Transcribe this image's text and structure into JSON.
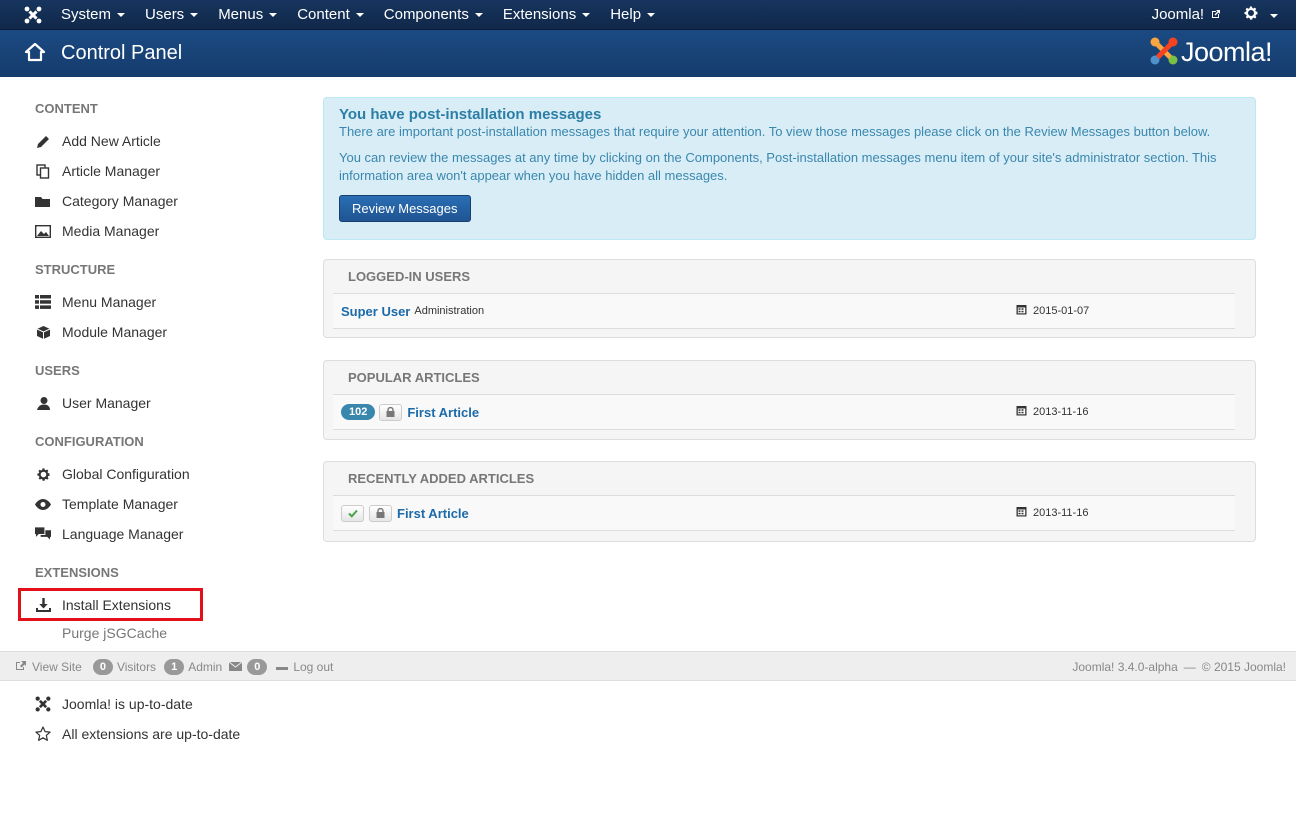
{
  "navbar": {
    "menu": [
      {
        "label": "System"
      },
      {
        "label": "Users"
      },
      {
        "label": "Menus"
      },
      {
        "label": "Content"
      },
      {
        "label": "Components"
      },
      {
        "label": "Extensions"
      },
      {
        "label": "Help"
      }
    ],
    "site_link": "Joomla!",
    "settings_icon": "gear-icon"
  },
  "header": {
    "title": "Control Panel",
    "logo_text": "Joomla!"
  },
  "sidebar": {
    "sections": [
      {
        "heading": "CONTENT",
        "items": [
          {
            "label": "Add New Article",
            "icon": "pencil-icon"
          },
          {
            "label": "Article Manager",
            "icon": "copy-icon"
          },
          {
            "label": "Category Manager",
            "icon": "folder-icon"
          },
          {
            "label": "Media Manager",
            "icon": "image-icon"
          }
        ]
      },
      {
        "heading": "STRUCTURE",
        "items": [
          {
            "label": "Menu Manager",
            "icon": "list-icon"
          },
          {
            "label": "Module Manager",
            "icon": "cube-icon"
          }
        ]
      },
      {
        "heading": "USERS",
        "items": [
          {
            "label": "User Manager",
            "icon": "user-icon"
          }
        ]
      },
      {
        "heading": "CONFIGURATION",
        "items": [
          {
            "label": "Global Configuration",
            "icon": "cog-icon"
          },
          {
            "label": "Template Manager",
            "icon": "eye-icon"
          },
          {
            "label": "Language Manager",
            "icon": "comments-icon"
          }
        ]
      },
      {
        "heading": "EXTENSIONS",
        "items": [
          {
            "label": "Install Extensions",
            "icon": "download-icon"
          },
          {
            "label": "Purge jSGCache",
            "icon": ""
          }
        ]
      }
    ]
  },
  "alert": {
    "heading": "You have post-installation messages",
    "text1": "There are important post-installation messages that require your attention. To view those messages please click on the Review Messages button below.",
    "text2": "You can review the messages at any time by clicking on the Components, Post-installation messages menu item of your site's administrator section. This information area won't appear when you have hidden all messages.",
    "button": "Review Messages"
  },
  "modules": {
    "logged_in": {
      "heading": "LOGGED-IN USERS",
      "user": "Super User",
      "client": "Administration",
      "date": "2015-01-07"
    },
    "popular": {
      "heading": "POPULAR ARTICLES",
      "hits": "102",
      "title": "First Article",
      "date": "2013-11-16"
    },
    "recent": {
      "heading": "RECENTLY ADDED ARTICLES",
      "title": "First Article",
      "date": "2013-11-16"
    }
  },
  "statusbar": {
    "view_site": "View Site",
    "visitors_count": "0",
    "visitors_label": "Visitors",
    "admin_count": "1",
    "admin_label": "Admin",
    "messages_count": "0",
    "logout": "Log out",
    "version": "Joomla! 3.4.0-alpha",
    "separator": "—",
    "copyright": "© 2015 Joomla!"
  },
  "bottom": {
    "items": [
      {
        "label": "Joomla! is up-to-date",
        "icon": "joomla-icon"
      },
      {
        "label": "All extensions are up-to-date",
        "icon": "star-icon"
      }
    ]
  }
}
